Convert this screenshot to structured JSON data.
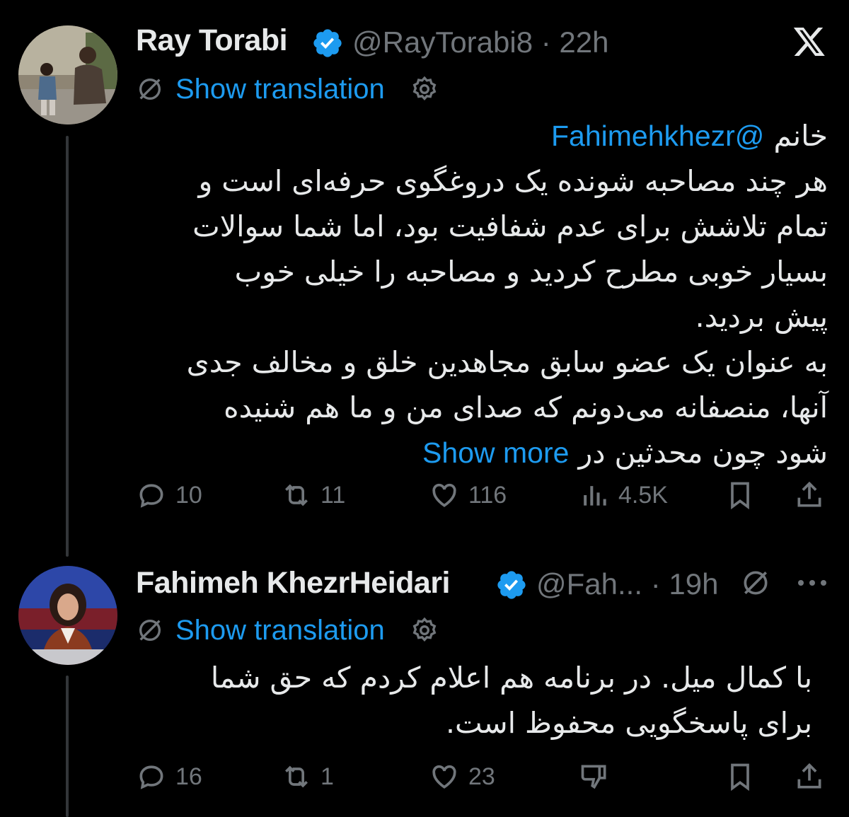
{
  "tweets": [
    {
      "author_name": "Ray Torabi",
      "handle": "@RayTorabi8",
      "separator": "·",
      "time": "22h",
      "show_translation": "Show translation",
      "text_mention": "@Fahimehkhezr",
      "text_lines": [
        "خانم",
        "هر چند مصاحبه شونده یک دروغگوی حرفه‌ای است و",
        "تمام تلاشش برای عدم شفافیت بود، اما شما سوالات",
        "بسیار خوبی مطرح کردید و مصاحبه را خیلی خوب",
        "پیش بردید.",
        "به عنوان یک عضو سابق مجاهدین خلق و مخالف جدی",
        "آنها، منصفانه می‌دونم که صدای من و ما هم شنیده",
        "شود چون محدثین در"
      ],
      "show_more": "Show more",
      "replies": "10",
      "reposts": "11",
      "likes": "116",
      "views": "4.5K"
    },
    {
      "author_name": "Fahimeh KhezrHeidari",
      "handle": "@Fah...",
      "separator": "·",
      "time": "19h",
      "show_translation": "Show translation",
      "text_lines": [
        "با کمال میل. در برنامه هم اعلام کردم که حق شما",
        "برای پاسخگویی محفوظ است."
      ],
      "replies": "16",
      "reposts": "1",
      "likes": "23"
    }
  ],
  "colors": {
    "background": "#000000",
    "text": "#e7e9ea",
    "muted": "#71767b",
    "link": "#1d9bf0",
    "verified": "#1d9bf0"
  },
  "icons": [
    "x-logo-icon",
    "verified-badge-icon",
    "translate-icon",
    "gear-icon",
    "reply-icon",
    "repost-icon",
    "like-icon",
    "views-icon",
    "bookmark-icon",
    "share-icon",
    "dislike-icon",
    "more-icon"
  ]
}
